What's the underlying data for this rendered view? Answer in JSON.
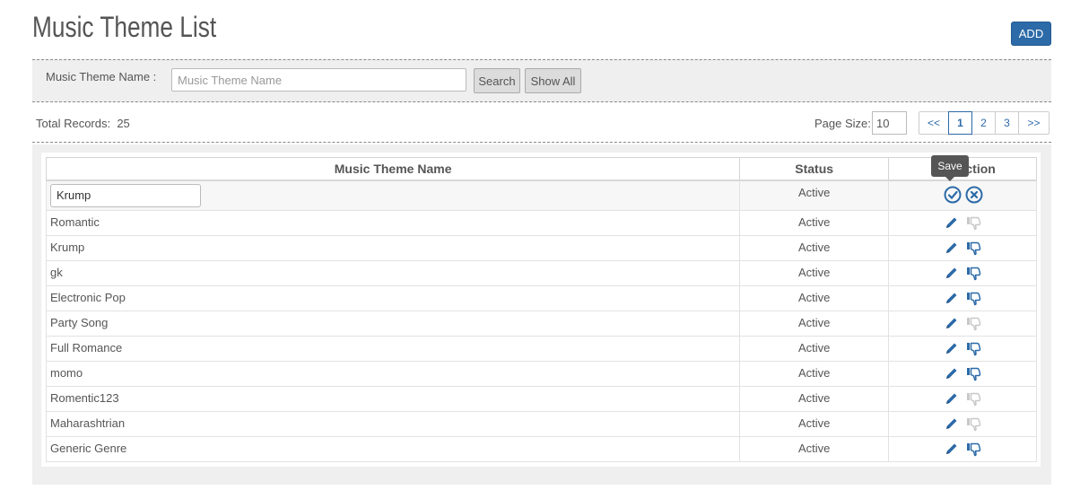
{
  "page": {
    "title": "Music Theme List",
    "add_label": "ADD"
  },
  "search": {
    "label": "Music Theme Name :",
    "placeholder": "Music Theme Name",
    "value": "",
    "search_label": "Search",
    "show_all_label": "Show All"
  },
  "summary": {
    "total_label": "Total Records:",
    "total_value": "25",
    "page_size_label": "Page Size:",
    "page_size_value": "10"
  },
  "pager": {
    "first": "<<",
    "pages": [
      "1",
      "2",
      "3"
    ],
    "current": "1",
    "last": ">>"
  },
  "grid": {
    "headers": {
      "name": "Music Theme Name",
      "status": "Status",
      "action": "Action"
    },
    "edit_row": {
      "value": "Krump",
      "status": "Active"
    },
    "rows": [
      {
        "name": "Romantic",
        "status": "Active",
        "dislike_active": false
      },
      {
        "name": "Krump",
        "status": "Active",
        "dislike_active": true
      },
      {
        "name": "gk",
        "status": "Active",
        "dislike_active": true
      },
      {
        "name": "Electronic Pop",
        "status": "Active",
        "dislike_active": true
      },
      {
        "name": "Party Song",
        "status": "Active",
        "dislike_active": false
      },
      {
        "name": "Full Romance",
        "status": "Active",
        "dislike_active": true
      },
      {
        "name": "momo",
        "status": "Active",
        "dislike_active": true
      },
      {
        "name": "Romentic123",
        "status": "Active",
        "dislike_active": false
      },
      {
        "name": "Maharashtrian",
        "status": "Active",
        "dislike_active": false
      },
      {
        "name": "Generic Genre",
        "status": "Active",
        "dislike_active": true
      }
    ]
  },
  "tooltip": {
    "text": "Save"
  },
  "colors": {
    "primary": "#2c6aa8",
    "muted_icon": "#c8c8c8"
  }
}
